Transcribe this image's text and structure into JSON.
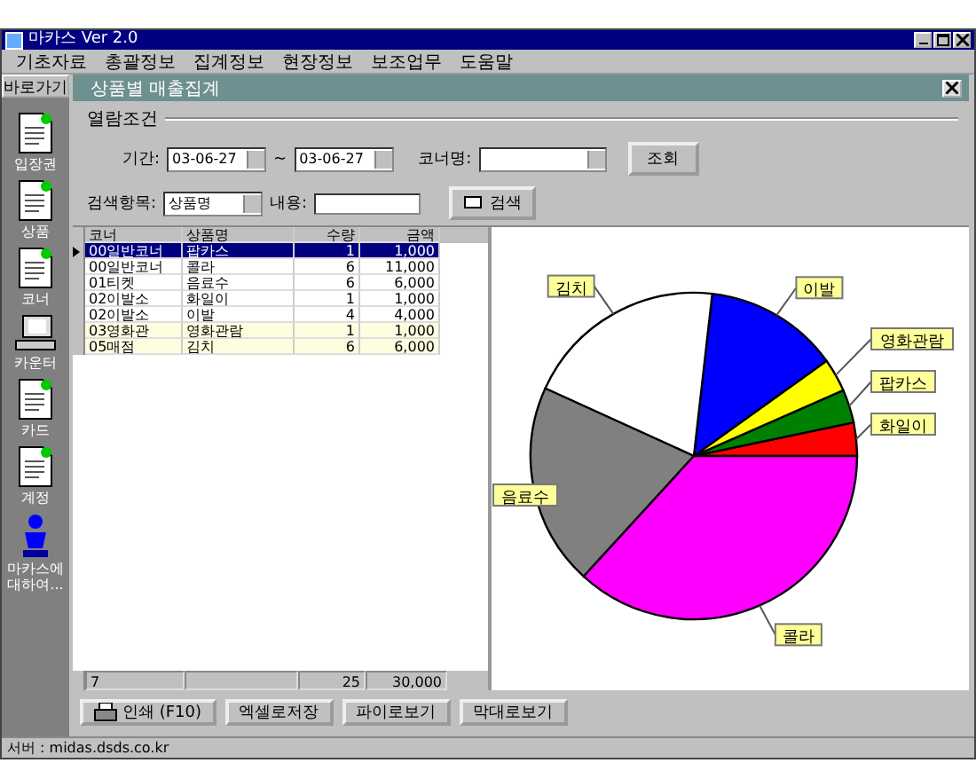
{
  "window": {
    "title": "마카스 Ver 2.0"
  },
  "menu": [
    "기초자료",
    "총괄정보",
    "집계정보",
    "현장정보",
    "보조업무",
    "도움말"
  ],
  "sidebar": {
    "title": "바로가기",
    "items": [
      {
        "label": "입장권",
        "kind": "document"
      },
      {
        "label": "상품",
        "kind": "document"
      },
      {
        "label": "코너",
        "kind": "document"
      },
      {
        "label": "카운터",
        "kind": "computer"
      },
      {
        "label": "카드",
        "kind": "document"
      },
      {
        "label": "계정",
        "kind": "document"
      },
      {
        "label": "마카스에 대하여...",
        "kind": "person"
      }
    ]
  },
  "panel": {
    "title": "상품별 매출집계"
  },
  "filter": {
    "group": "열람조건",
    "period_label": "기간:",
    "date_from": "03-06-27",
    "separator": "~",
    "date_to": "03-06-27",
    "corner_label": "코너명:",
    "query_button": "조회",
    "search_label": "검색항목:",
    "search_field": "상품명",
    "content_label": "내용:",
    "search_button": "검색"
  },
  "table": {
    "columns": [
      "코너",
      "상품명",
      "수량",
      "금액"
    ],
    "rows": [
      {
        "cells": [
          "00일반코너",
          "팝카스",
          "1",
          "1,000"
        ],
        "selected": true,
        "shaded": false
      },
      {
        "cells": [
          "00일반코너",
          "콜라",
          "6",
          "11,000"
        ],
        "selected": false,
        "shaded": false
      },
      {
        "cells": [
          "01티켓",
          "음료수",
          "6",
          "6,000"
        ],
        "selected": false,
        "shaded": false
      },
      {
        "cells": [
          "02이발소",
          "화일이",
          "1",
          "1,000"
        ],
        "selected": false,
        "shaded": false
      },
      {
        "cells": [
          "02이발소",
          "이발",
          "4",
          "4,000"
        ],
        "selected": false,
        "shaded": false
      },
      {
        "cells": [
          "03영화관",
          "영화관람",
          "1",
          "1,000"
        ],
        "selected": false,
        "shaded": true
      },
      {
        "cells": [
          "05매점",
          "김치",
          "6",
          "6,000"
        ],
        "selected": false,
        "shaded": true
      }
    ],
    "footer": [
      "7",
      "25",
      "30,000"
    ]
  },
  "chart": {
    "chart_data": {
      "type": "pie",
      "categories": [
        "화일이",
        "팝카스",
        "영화관람",
        "이발",
        "김치",
        "음료수",
        "콜라"
      ],
      "series": [
        {
          "values": [
            3.3,
            3.3,
            3.3,
            13.3,
            20,
            20,
            36.8
          ],
          "colors": [
            "#ff0000",
            "#008000",
            "#ffff00",
            "#0000ff",
            "#ffffff",
            "#808080",
            "#ff00ff"
          ]
        }
      ]
    }
  },
  "buttons": [
    "인쇄 (F10)",
    "엑셀로저장",
    "파이로보기",
    "막대로보기"
  ],
  "status_bar": "서버 : midas.dsds.co.kr"
}
